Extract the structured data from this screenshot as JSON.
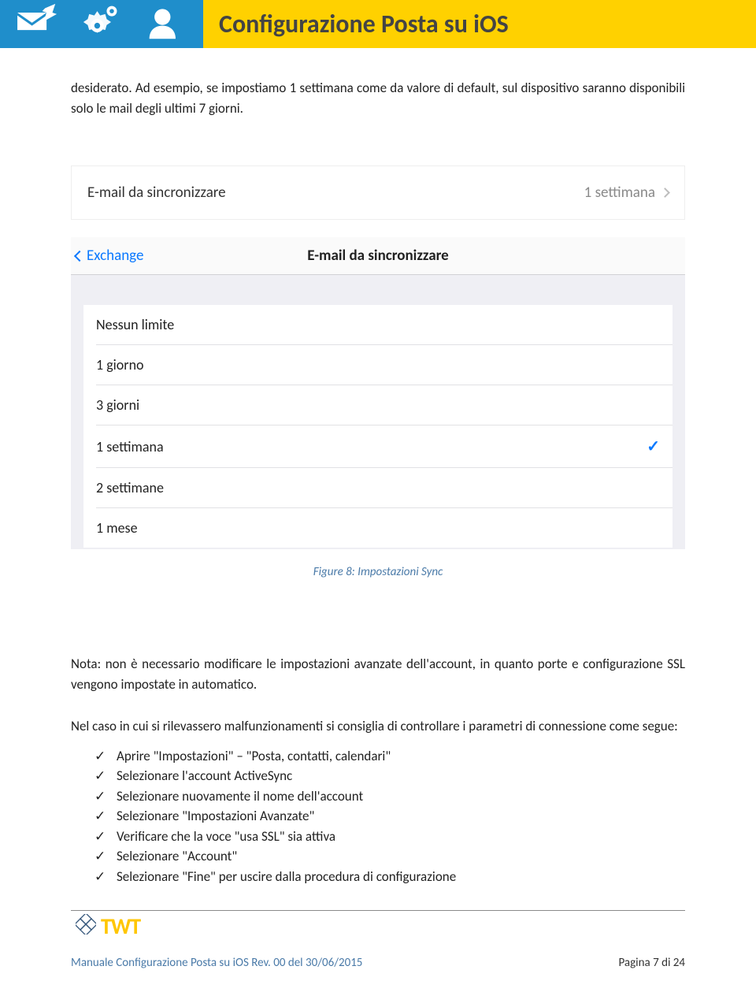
{
  "header": {
    "title": "Configurazione Posta su iOS"
  },
  "body": {
    "intro": "desiderato. Ad esempio, se impostiamo 1 settimana come da valore di default, sul dispositivo saranno disponibili solo le mail degli ultimi 7 giorni."
  },
  "ios": {
    "sync_row_label": "E-mail da sincronizzare",
    "sync_row_value": "1 settimana",
    "back_label": "Exchange",
    "screen_title": "E-mail da sincronizzare",
    "options": [
      {
        "label": "Nessun limite",
        "selected": false
      },
      {
        "label": "1 giorno",
        "selected": false
      },
      {
        "label": "3 giorni",
        "selected": false
      },
      {
        "label": "1 settimana",
        "selected": true
      },
      {
        "label": "2 settimane",
        "selected": false
      },
      {
        "label": "1 mese",
        "selected": false
      }
    ]
  },
  "caption": "Figure 8: Impostazioni Sync",
  "note": "Nota: non è necessario modificare le impostazioni avanzate dell'account, in quanto porte e configurazione SSL vengono impostate in automatico.",
  "troubleshoot_intro": "Nel caso in cui si rilevassero malfunzionamenti si consiglia di controllare i parametri di connessione come segue:",
  "steps": [
    "Aprire \"Impostazioni\" – \"Posta, contatti, calendari\"",
    "Selezionare l'account ActiveSync",
    "Selezionare nuovamente il nome dell'account",
    "Selezionare \"Impostazioni Avanzate\"",
    "Verificare che la voce \"usa SSL\" sia attiva",
    "Selezionare \"Account\"",
    "Selezionare \"Fine\" per uscire dalla procedura di configurazione"
  ],
  "footer": {
    "logo_text": "TWT",
    "doc_ref": "Manuale Configurazione Posta su iOS Rev. 00 del 30/06/2015",
    "page_label": "Pagina 7 di 24"
  }
}
